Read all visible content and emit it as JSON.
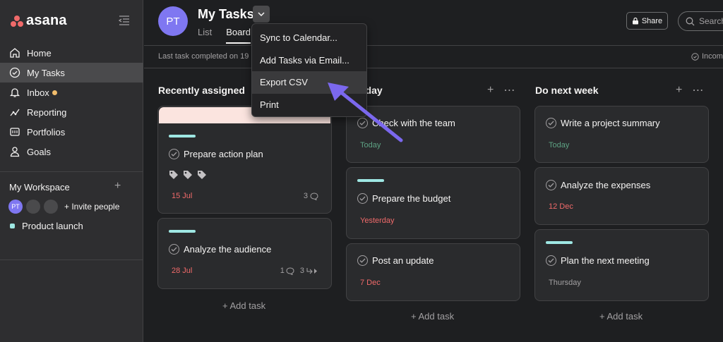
{
  "brand": {
    "name": "asana"
  },
  "nav": {
    "items": [
      {
        "label": "Home",
        "icon": "home-icon"
      },
      {
        "label": "My Tasks",
        "icon": "check-circle-icon",
        "active": true
      },
      {
        "label": "Inbox",
        "icon": "bell-icon",
        "badge": true
      },
      {
        "label": "Reporting",
        "icon": "chart-line-icon"
      },
      {
        "label": "Portfolios",
        "icon": "folder-icon"
      },
      {
        "label": "Goals",
        "icon": "person-icon"
      }
    ]
  },
  "workspace": {
    "title": "My Workspace",
    "avatar_initials": "PT",
    "invite_label": "Invite people",
    "project_label": "Product launch"
  },
  "header": {
    "avatar_initials": "PT",
    "title": "My Tasks",
    "tabs": [
      "List",
      "Board"
    ],
    "share_label": "Share",
    "search_placeholder": "Search",
    "last_task": "Last task completed on 19",
    "incomplete_label": "Incom"
  },
  "dropdown": {
    "items": [
      "Sync to Calendar...",
      "Add Tasks via Email...",
      "Export CSV",
      "Print"
    ]
  },
  "columns": [
    {
      "title": "Recently assigned",
      "cards": [
        {
          "task": "Prepare action plan",
          "due": "15 Jul",
          "comments": "3"
        },
        {
          "task": "Analyze the audience",
          "due": "28 Jul",
          "comments": "1",
          "subtasks": "3"
        }
      ],
      "add_label": "+ Add task"
    },
    {
      "title": "oday",
      "cards": [
        {
          "task": "Check with the team",
          "due": "Today"
        },
        {
          "task": "Prepare the budget",
          "due": "Yesterday"
        },
        {
          "task": "Post an update",
          "due": "7 Dec"
        }
      ],
      "add_label": "+ Add task"
    },
    {
      "title": "Do next week",
      "cards": [
        {
          "task": "Write a project summary",
          "due": "Today"
        },
        {
          "task": "Analyze the expenses",
          "due": "12 Dec"
        },
        {
          "task": "Plan the next meeting",
          "due": "Thursday"
        }
      ],
      "add_label": "+ Add task"
    }
  ]
}
